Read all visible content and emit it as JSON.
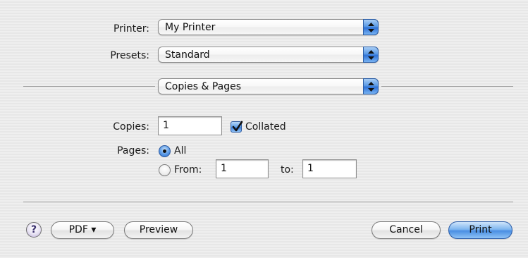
{
  "printer": {
    "label": "Printer:",
    "value": "My Printer"
  },
  "presets": {
    "label": "Presets:",
    "value": "Standard"
  },
  "panel": {
    "value": "Copies & Pages"
  },
  "copies": {
    "label": "Copies:",
    "value": "1",
    "collated_label": "Collated",
    "collated_checked": true
  },
  "pages": {
    "label": "Pages:",
    "all_label": "All",
    "all_selected": true,
    "from_label": "From:",
    "from_value": "1",
    "to_label": "to:",
    "to_value": "1"
  },
  "buttons": {
    "help": "?",
    "pdf": "PDF ▾",
    "preview": "Preview",
    "cancel": "Cancel",
    "print": "Print"
  },
  "colors": {
    "accent": "#4a8ee3",
    "background": "#ececec"
  }
}
